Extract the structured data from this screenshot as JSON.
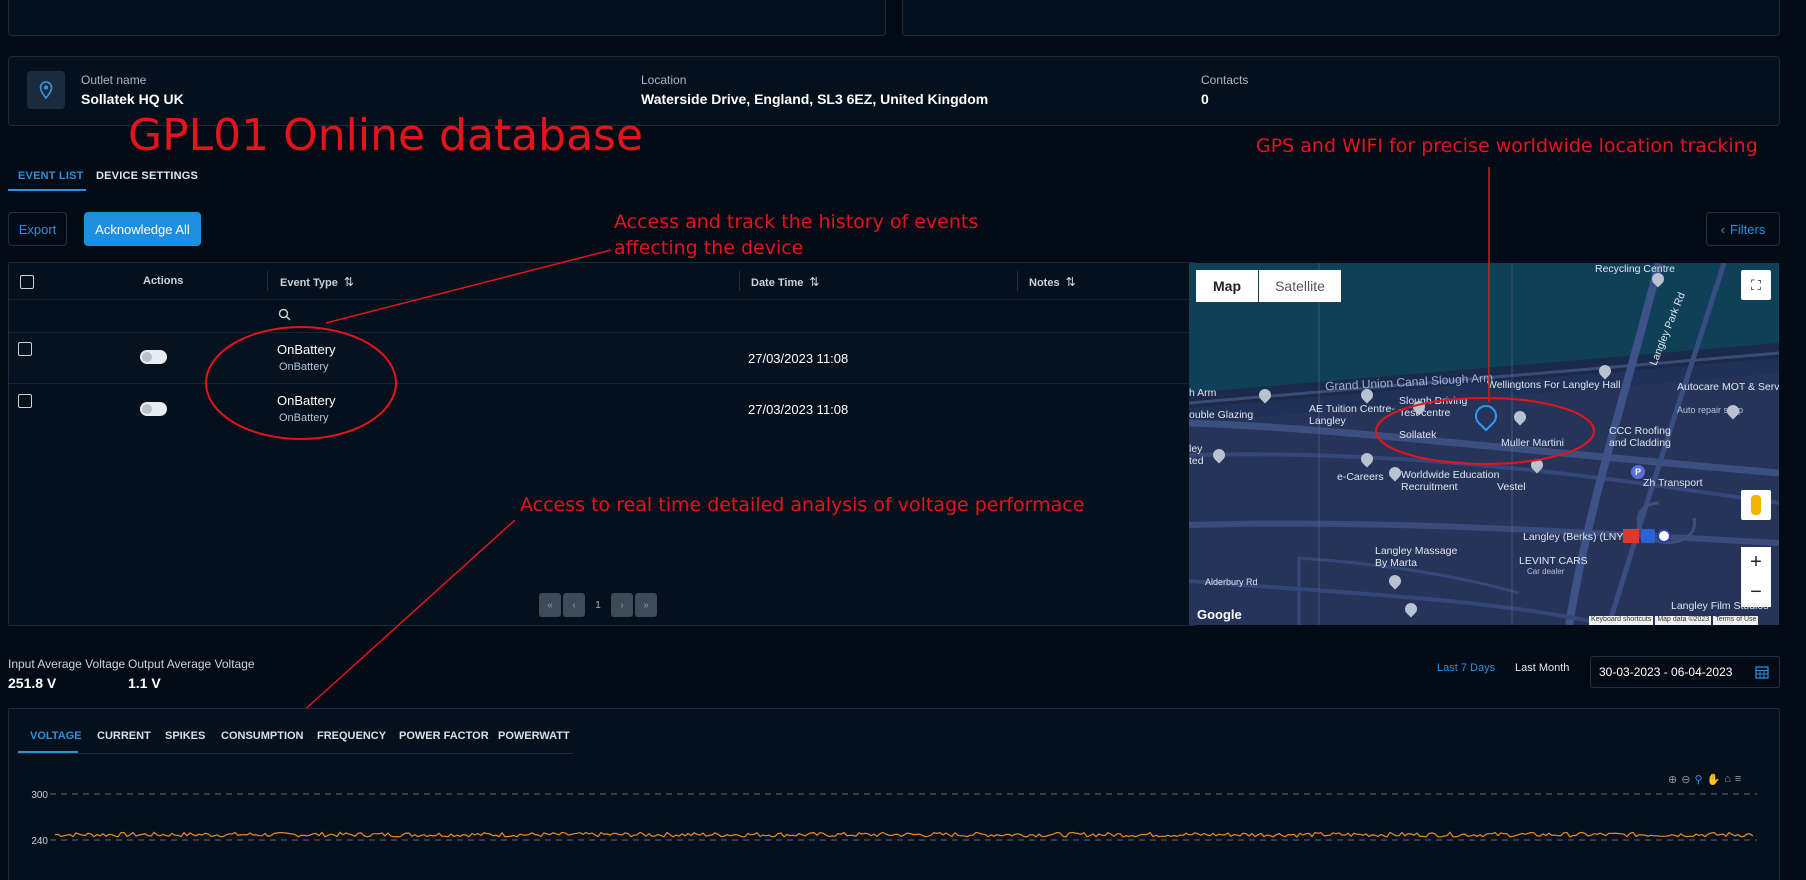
{
  "outlet": {
    "name_label": "Outlet name",
    "name_value": "Sollatek HQ UK",
    "location_label": "Location",
    "location_value": "Waterside Drive, England, SL3 6EZ, United Kingdom",
    "contacts_label": "Contacts",
    "contacts_value": "0",
    "icon": "location-pin-icon"
  },
  "tabs": [
    {
      "label": "EVENT LIST",
      "active": true
    },
    {
      "label": "DEVICE SETTINGS",
      "active": false
    }
  ],
  "toolbar": {
    "export_label": "Export",
    "ack_label": "Acknowledge All",
    "filters_label": "Filters"
  },
  "table": {
    "headers": {
      "actions": "Actions",
      "event_type": "Event Type",
      "date_time": "Date Time",
      "notes": "Notes"
    },
    "rows": [
      {
        "event": "OnBattery",
        "event_sub": "OnBattery",
        "date": "27/03/2023 11:08"
      },
      {
        "event": "OnBattery",
        "event_sub": "OnBattery",
        "date": "27/03/2023 11:08"
      }
    ],
    "pagination": {
      "first": "«",
      "prev": "‹",
      "page": "1",
      "next": "›",
      "last": "»"
    }
  },
  "map": {
    "map_label": "Map",
    "satellite_label": "Satellite",
    "attribution": {
      "google": "Google",
      "shortcuts": "Keyboard shortcuts",
      "data": "Map data ©2023",
      "terms": "Terms of Use"
    },
    "labels": [
      "Recycling Centre",
      "Grand Union Canal Slough Arm",
      "Wellingtons For Langley Hall",
      "Autocare MOT & Service Centre",
      "Auto repair shop",
      "Langley Park Rd",
      "Slough Driving Test centre",
      "AE Tuition Centre- Langley",
      "ouble Glazing",
      "Sollatek",
      "Muller Martini",
      "CCC Roofing and Cladding",
      "e-Careers",
      "Worldwide Education Recruitment",
      "Vestel",
      "Zh Transport",
      "Langley (Berks) (LNY)",
      "Langley Massage By Marta",
      "LEVINT CARS",
      "Car dealer",
      "Alderbury Rd",
      "Langley Film Studios",
      "h Arm",
      "ley",
      "ted"
    ]
  },
  "voltage": {
    "input_label": "Input Average Voltage",
    "input_value": "251.8 V",
    "output_label": "Output Average Voltage",
    "output_value": "1.1 V",
    "last7_label": "Last 7 Days",
    "lastmonth_label": "Last Month",
    "date_range": "30-03-2023 - 06-04-2023"
  },
  "chart_tabs": [
    {
      "label": "VOLTAGE",
      "active": true
    },
    {
      "label": "CURRENT",
      "active": false
    },
    {
      "label": "SPIKES",
      "active": false
    },
    {
      "label": "CONSUMPTION",
      "active": false
    },
    {
      "label": "FREQUENCY",
      "active": false
    },
    {
      "label": "POWER FACTOR",
      "active": false
    },
    {
      "label": "POWERWATT",
      "active": false
    }
  ],
  "annotations": {
    "title": "GPL01 Online database",
    "gps": "GPS and WIFI for precise worldwide location tracking",
    "events_1": "Access and track the history of  events",
    "events_2": "affecting the device",
    "voltage": "Access to real time detailed analysis of voltage performace"
  },
  "chart_data": {
    "type": "line",
    "y_ticks": [
      "300",
      "240"
    ],
    "ylim": [
      220,
      310
    ],
    "series": [
      {
        "color": "#f08a1d",
        "level": 247,
        "noise": 3
      }
    ],
    "grid": true
  },
  "colors": {
    "accent": "#2b8fe0",
    "annotation": "#e5141b",
    "series": "#f08a1d"
  }
}
